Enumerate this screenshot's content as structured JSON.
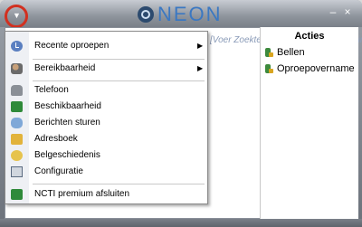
{
  "app": {
    "title": "NEON",
    "minimize": "–",
    "close": "×"
  },
  "search": {
    "placeholder": "[Voer Zoektekst of te bellen nummer ir"
  },
  "actions": {
    "title": "Acties",
    "items": [
      {
        "label": "Bellen",
        "icon": "phone-icon"
      },
      {
        "label": "Oproepovername",
        "icon": "phone-icon"
      }
    ]
  },
  "menu": {
    "items": [
      {
        "label": "Recente oproepen",
        "icon": "clock-icon",
        "submenu": true
      },
      {
        "label": "Bereikbaarheid",
        "icon": "people-icon",
        "submenu": true
      },
      {
        "label": "Telefoon",
        "icon": "telephone-icon",
        "submenu": false
      },
      {
        "label": "Beschikbaarheid",
        "icon": "availability-icon",
        "submenu": false
      },
      {
        "label": "Berichten sturen",
        "icon": "message-icon",
        "submenu": false
      },
      {
        "label": "Adresboek",
        "icon": "addressbook-icon",
        "submenu": false
      },
      {
        "label": "Belgeschiedenis",
        "icon": "history-icon",
        "submenu": false
      },
      {
        "label": "Configuratie",
        "icon": "configuration-icon",
        "submenu": false
      },
      {
        "label": "NCTI premium afsluiten",
        "icon": "exit-icon",
        "submenu": false
      }
    ],
    "submenu_arrow": "▶"
  },
  "colors": {
    "highlight_ring": "#d23020",
    "logo": "#3b78c2"
  }
}
